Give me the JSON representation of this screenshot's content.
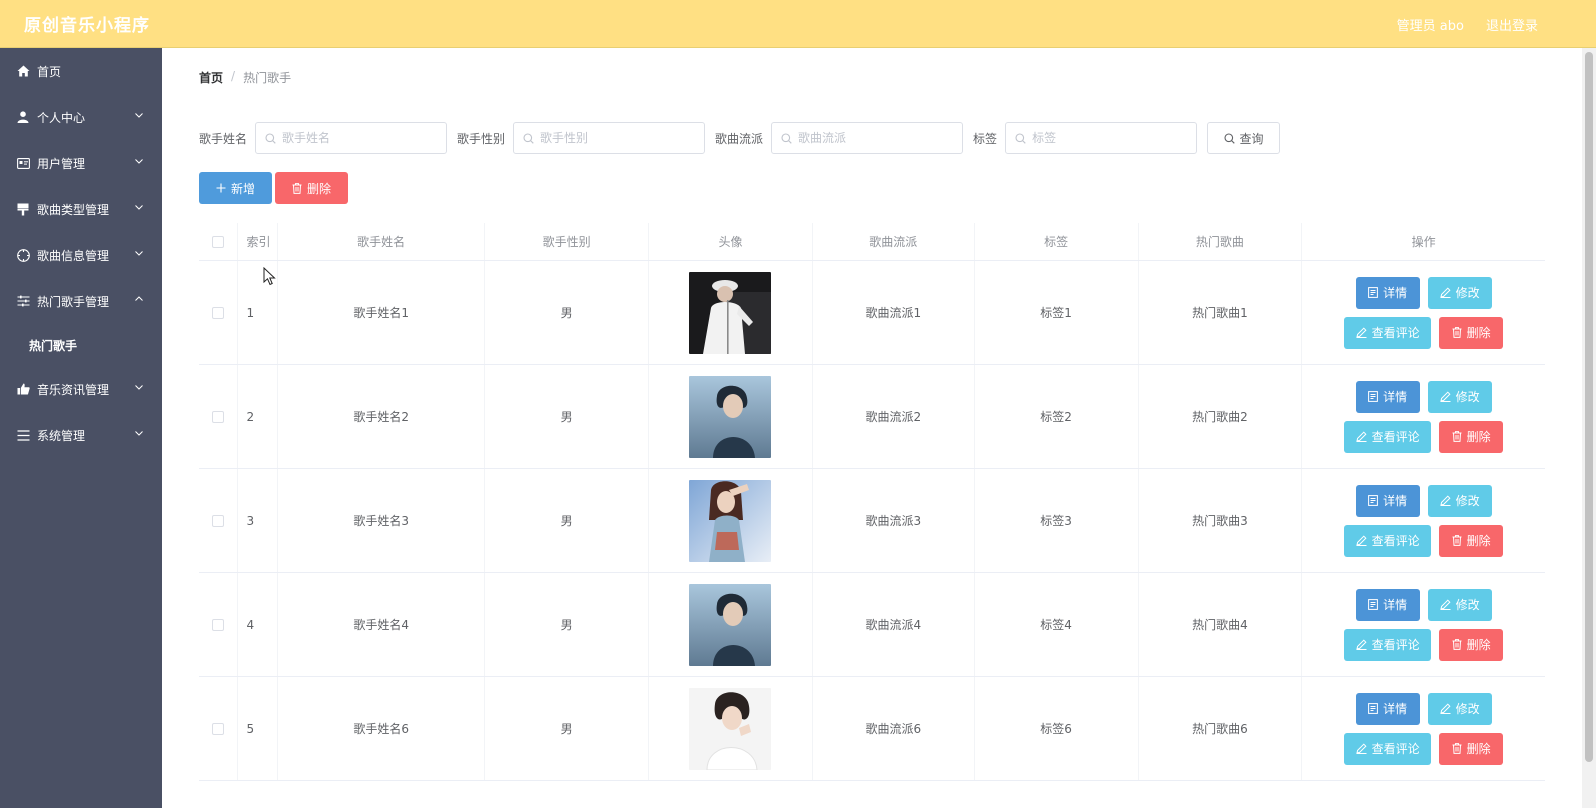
{
  "app": {
    "title": "原创音乐小程序"
  },
  "header": {
    "user": "管理员 abo",
    "logout": "退出登录"
  },
  "sidebar": {
    "items": [
      {
        "label": "首页",
        "icon": "home-icon",
        "expandable": false
      },
      {
        "label": "个人中心",
        "icon": "user-icon",
        "expandable": true
      },
      {
        "label": "用户管理",
        "icon": "id-card-icon",
        "expandable": true
      },
      {
        "label": "歌曲类型管理",
        "icon": "brush-icon",
        "expandable": true
      },
      {
        "label": "歌曲信息管理",
        "icon": "compass-icon",
        "expandable": true
      },
      {
        "label": "热门歌手管理",
        "icon": "sliders-icon",
        "expandable": true,
        "open": true
      },
      {
        "label": "音乐资讯管理",
        "icon": "thumb-icon",
        "expandable": true
      },
      {
        "label": "系统管理",
        "icon": "menu-icon",
        "expandable": true
      }
    ],
    "submenu": {
      "label": "热门歌手"
    }
  },
  "breadcrumb": {
    "home": "首页",
    "separator": "/",
    "current": "热门歌手"
  },
  "search": {
    "fields": [
      {
        "label": "歌手姓名",
        "placeholder": "歌手姓名"
      },
      {
        "label": "歌手性别",
        "placeholder": "歌手性别"
      },
      {
        "label": "歌曲流派",
        "placeholder": "歌曲流派"
      },
      {
        "label": "标签",
        "placeholder": "标签"
      }
    ],
    "query_label": "查询"
  },
  "actions": {
    "add_label": "新增",
    "delete_label": "删除"
  },
  "table": {
    "columns": {
      "index": "索引",
      "name": "歌手姓名",
      "gender": "歌手性别",
      "avatar": "头像",
      "genre": "歌曲流派",
      "tag": "标签",
      "song": "热门歌曲",
      "ops": "操作"
    },
    "ops_labels": {
      "detail": "详情",
      "edit": "修改",
      "comments": "查看评论",
      "delete": "删除"
    },
    "rows": [
      {
        "index": "1",
        "name": "歌手姓名1",
        "gender": "男",
        "genre": "歌曲流派1",
        "tag": "标签1",
        "song": "热门歌曲1"
      },
      {
        "index": "2",
        "name": "歌手姓名2",
        "gender": "男",
        "genre": "歌曲流派2",
        "tag": "标签2",
        "song": "热门歌曲2"
      },
      {
        "index": "3",
        "name": "歌手姓名3",
        "gender": "男",
        "genre": "歌曲流派3",
        "tag": "标签3",
        "song": "热门歌曲3"
      },
      {
        "index": "4",
        "name": "歌手姓名4",
        "gender": "男",
        "genre": "歌曲流派4",
        "tag": "标签4",
        "song": "热门歌曲4"
      },
      {
        "index": "5",
        "name": "歌手姓名6",
        "gender": "男",
        "genre": "歌曲流派6",
        "tag": "标签6",
        "song": "热门歌曲6"
      }
    ]
  },
  "colors": {
    "topbar": "#ffe083",
    "sidebar": "#4a5064",
    "primary": "#4f9bdc",
    "info": "#60cbe8",
    "danger": "#f8676a"
  }
}
